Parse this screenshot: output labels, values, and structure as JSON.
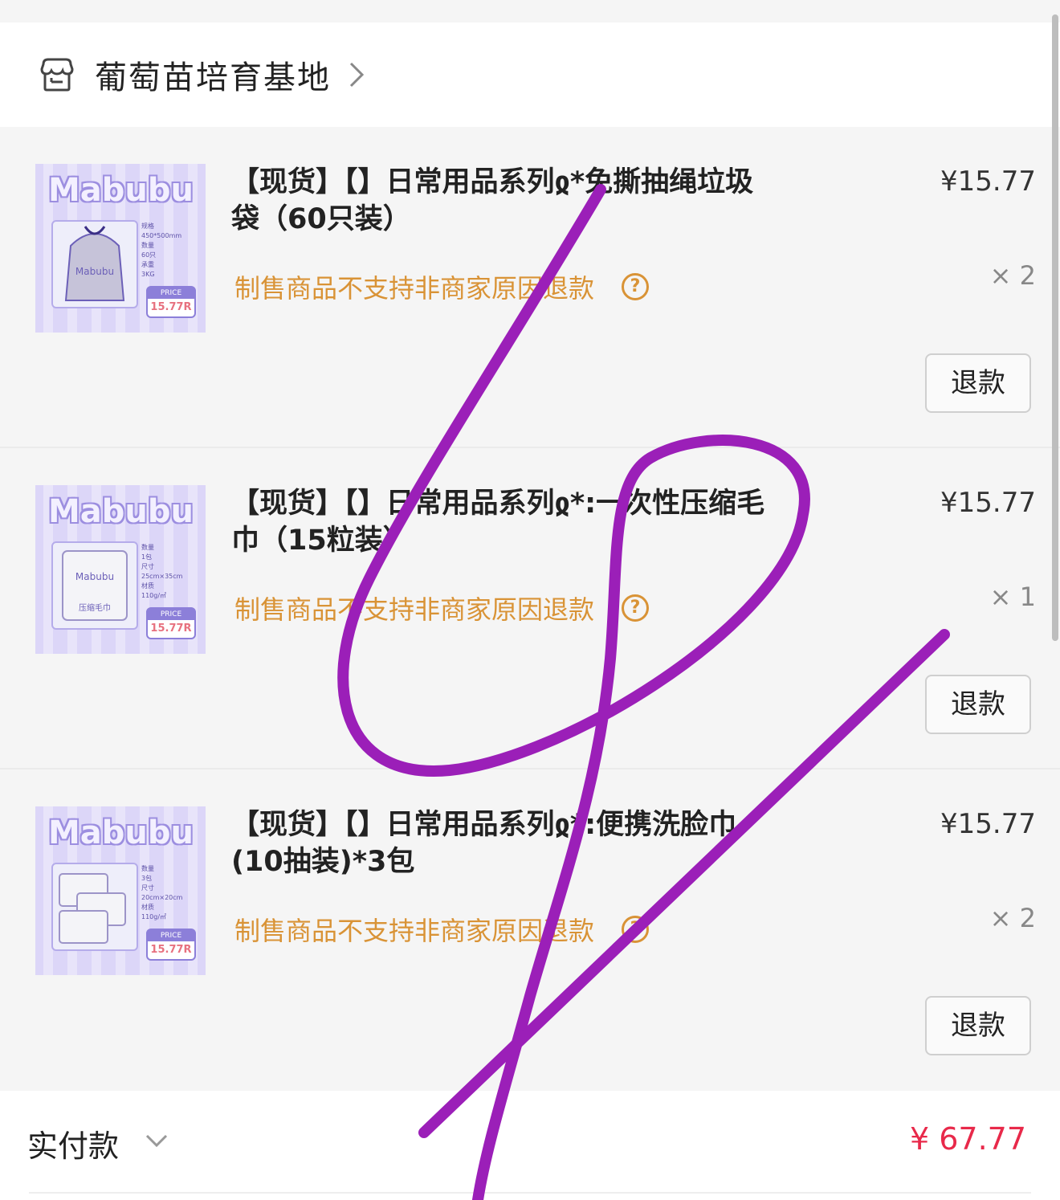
{
  "shop": {
    "name": "葡萄苗培育基地",
    "icon": "store-icon"
  },
  "items": [
    {
      "title": "【现货】【】日常用品系列ჲ*免撕抽绳垃圾袋（60只装）",
      "notice": "制售商品不支持非商家原因退款",
      "price": "¥15.77",
      "qty": "× 2",
      "refund_label": "退款",
      "thumb": {
        "brand": "Mabubu",
        "price_tag": "PRICE",
        "price_val": "15.77R"
      }
    },
    {
      "title": "【现货】【】日常用品系列ჲ*:一次性压缩毛巾（15粒装）",
      "notice": "制售商品不支持非商家原因退款",
      "price": "¥15.77",
      "qty": "× 1",
      "refund_label": "退款",
      "thumb": {
        "brand": "Mabubu",
        "price_tag": "PRICE",
        "price_val": "15.77R"
      }
    },
    {
      "title": "【现货】【】日常用品系列ჲ*:便携洗脸巾(10抽装)*3包",
      "notice": "制售商品不支持非商家原因退款",
      "price": "¥15.77",
      "qty": "× 2",
      "refund_label": "退款",
      "thumb": {
        "brand": "Mabubu",
        "price_tag": "PRICE",
        "price_val": "15.77R"
      }
    }
  ],
  "total": {
    "label": "实付款",
    "amount": "¥ 67.77"
  },
  "colors": {
    "notice": "#d99336",
    "total_amount": "#e8294a",
    "scribble": "#9b1fb8"
  }
}
